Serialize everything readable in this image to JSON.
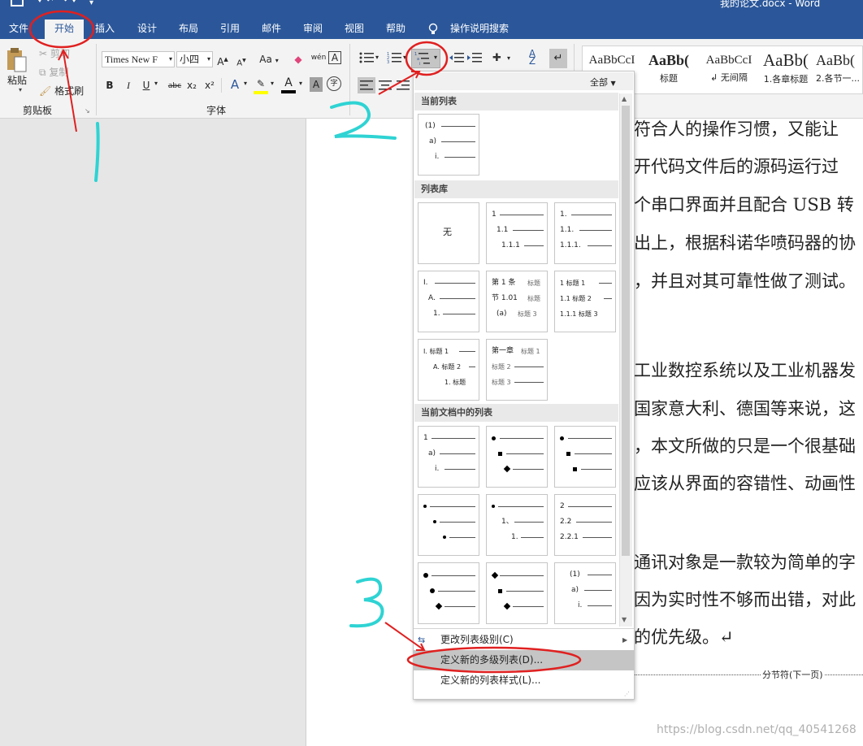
{
  "window": {
    "title": "我的论文.docx  -  Word"
  },
  "qat": {
    "save_icon": "save-icon",
    "undo_icon": "undo-icon",
    "redo_icon": "redo-icon",
    "customize_icon": "customize-qat-icon"
  },
  "tabs": [
    "文件",
    "开始",
    "插入",
    "设计",
    "布局",
    "引用",
    "邮件",
    "审阅",
    "视图",
    "帮助"
  ],
  "tell_me": "操作说明搜索",
  "ribbon": {
    "clipboard": {
      "paste": "粘贴",
      "cut": "剪切",
      "copy": "复制",
      "format_painter": "格式刷",
      "group_label": "剪贴板"
    },
    "font": {
      "font_name": "Times New F",
      "font_size": "小四",
      "group_label": "字体",
      "case_btn": "Aa",
      "grow": "A",
      "shrink": "A",
      "bold": "B",
      "italic": "I",
      "underline": "U",
      "strike": "abc",
      "sub": "x₂",
      "sup": "x²",
      "wen": "wén",
      "char_border": "A",
      "char_shade": "A",
      "enclose": "字"
    },
    "styles": [
      {
        "preview": "AaBbCcI",
        "name": "",
        "kind": "normal"
      },
      {
        "preview": "AaBb(",
        "name": "标题",
        "kind": "big"
      },
      {
        "preview": "AaBbCcI",
        "name": "↲ 无间隔",
        "kind": "normal"
      },
      {
        "preview": "AaBb(",
        "name": "1.各章标题",
        "kind": "bigger"
      },
      {
        "preview": "AaBb(",
        "name": "2.各节一...",
        "kind": "big"
      }
    ]
  },
  "menu": {
    "filter": "全部",
    "sections": {
      "current": "当前列表",
      "library": "列表库",
      "in_doc": "当前文档中的列表"
    },
    "none_label": "无",
    "change_level": "更改列表级别(C)",
    "define_new_multilevel": "定义新的多级列表(D)...",
    "define_new_style": "定义新的列表样式(L)..."
  },
  "tile_text": {
    "t1": [
      "(1)",
      "a)",
      "i."
    ],
    "t2": [
      "1",
      "1.1",
      "1.1.1"
    ],
    "t3": [
      "1.",
      "1.1.",
      "1.1.1."
    ],
    "t4": [
      "I.",
      "A.",
      "1."
    ],
    "t5": [
      "第 1 条",
      "标题",
      "节 1.01",
      "标题",
      "(a)",
      "标题 3"
    ],
    "t6": [
      "1 标题 1",
      "1.1 标题 2",
      "1.1.1 标题 3"
    ],
    "t7": [
      "I. 标题 1",
      "A. 标题 2",
      "1. 标题"
    ],
    "t8": [
      "第一章",
      "标题 1",
      "标题 2",
      "标题 3"
    ],
    "d1": [
      "1",
      "a)",
      "i."
    ],
    "d5": [
      "1、",
      "1."
    ],
    "d6": [
      "2",
      "2.2",
      "2.2.1"
    ],
    "d9": [
      "(1)",
      "a)",
      "i."
    ]
  },
  "document": {
    "lines": [
      "符合人的操作习惯，又能让",
      "开代码文件后的源码运行过",
      "个串口界面并且配合 USB 转",
      "出上，根据科诺华喷码器的协",
      "，并且对其可靠性做了测试。",
      "工业数控系统以及工业机器发",
      "国家意大利、德国等来说，这",
      "，本文所做的只是一个很基础",
      "应该从界面的容错性、动画性",
      "通讯对象是一款较为简单的字",
      "因为实时性不够而出错，对此",
      "的优先级。↵"
    ],
    "section_break": "分节符(下一页)",
    "watermark": "https://blog.csdn.net/qq_40541268"
  },
  "annotations": {
    "one": "1",
    "two": "2",
    "three": "3",
    "circle_color": "#e02020",
    "marker_color": "#2fd3d3"
  }
}
